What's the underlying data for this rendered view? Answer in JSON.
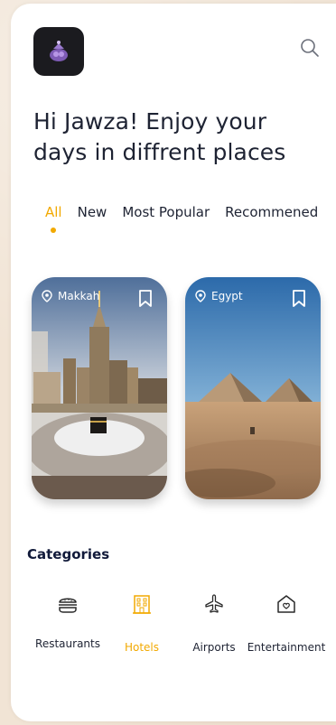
{
  "greeting": {
    "line1": "Hi Jawza! Enjoy your",
    "line2": "days in diffrent places"
  },
  "tabs": [
    {
      "label": "All",
      "active": true
    },
    {
      "label": "New",
      "active": false
    },
    {
      "label": "Most Popular",
      "active": false
    },
    {
      "label": "Recommened",
      "active": false
    }
  ],
  "places": [
    {
      "name": "Makkah",
      "icons": [
        "location-pin-icon",
        "bookmark-icon"
      ]
    },
    {
      "name": "Egypt",
      "icons": [
        "location-pin-icon",
        "bookmark-icon"
      ]
    }
  ],
  "categories": {
    "title": "Categories",
    "items": [
      {
        "label": "Restaurants",
        "icon": "burger-icon",
        "active": false
      },
      {
        "label": "Hotels",
        "icon": "hotel-icon",
        "active": true
      },
      {
        "label": "Airports",
        "icon": "airplane-icon",
        "active": false
      },
      {
        "label": "Entertainment",
        "icon": "house-heart-icon",
        "active": false
      }
    ]
  },
  "colors": {
    "accent": "#f2a900",
    "text": "#1e2333",
    "heading": "#111a3a",
    "background": "#f1e4d5"
  }
}
